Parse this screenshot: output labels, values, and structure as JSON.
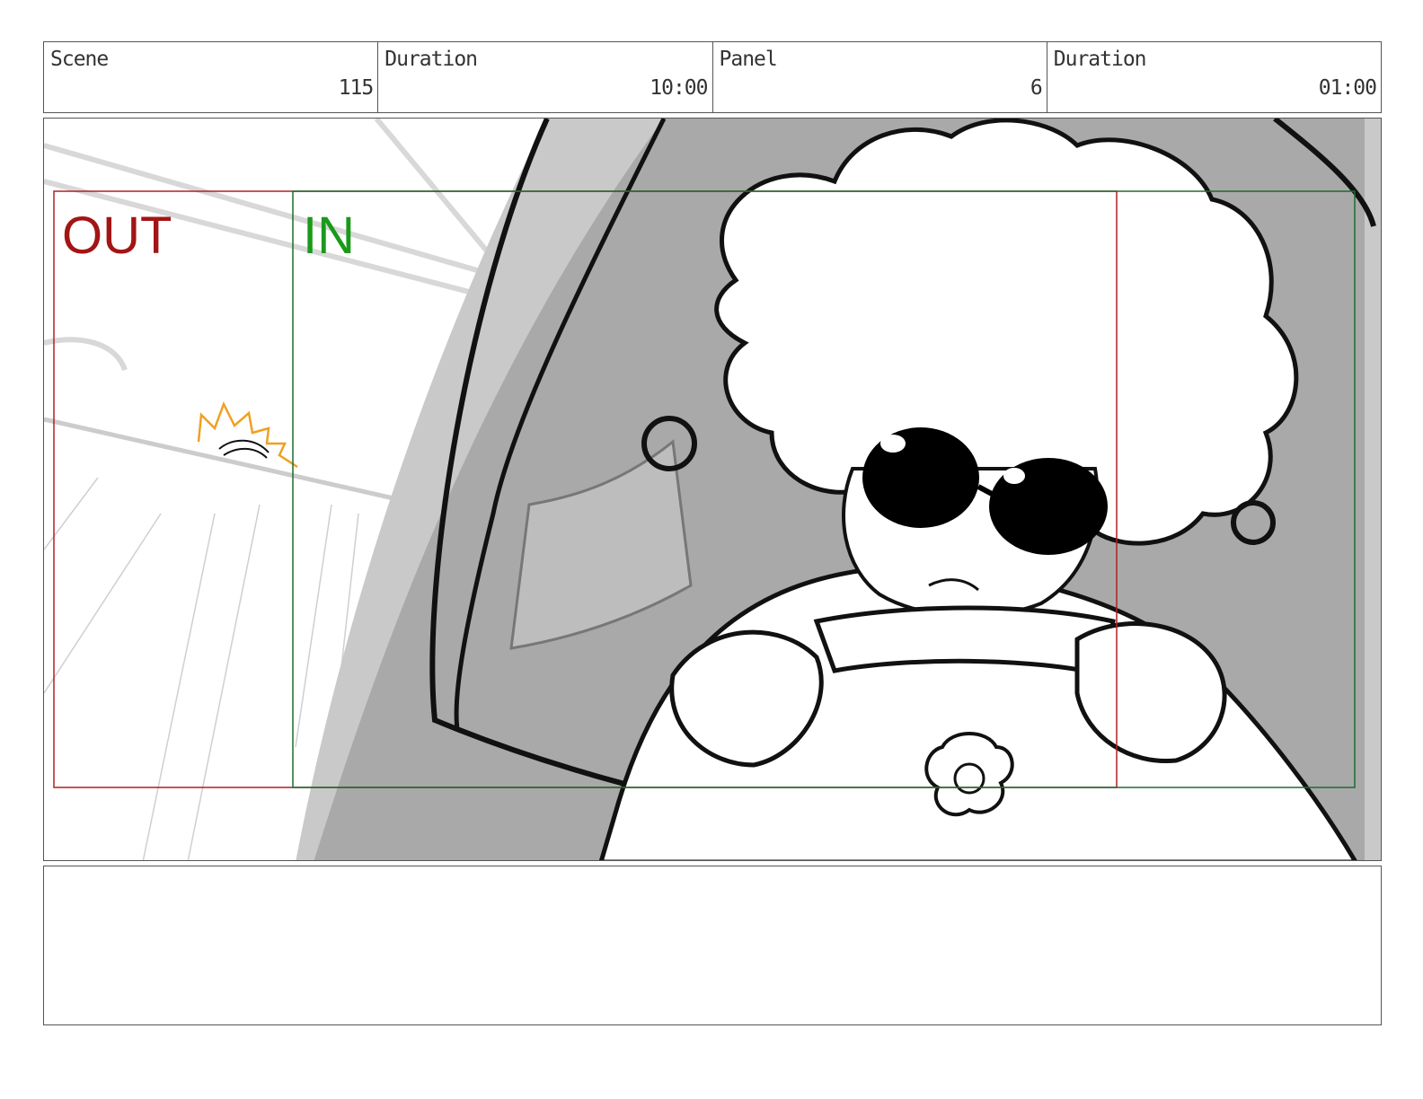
{
  "header": {
    "scene_label": "Scene",
    "scene_value": "115",
    "scene_duration_label": "Duration",
    "scene_duration_value": "10:00",
    "panel_label": "Panel",
    "panel_value": "6",
    "panel_duration_label": "Duration",
    "panel_duration_value": "01:00"
  },
  "panel": {
    "out_label": "OUT",
    "in_label": "IN",
    "colors": {
      "out_frame": "#b02020",
      "in_frame": "#1f6b2f",
      "sun": "#f0a020"
    }
  },
  "notes": {
    "text": ""
  }
}
